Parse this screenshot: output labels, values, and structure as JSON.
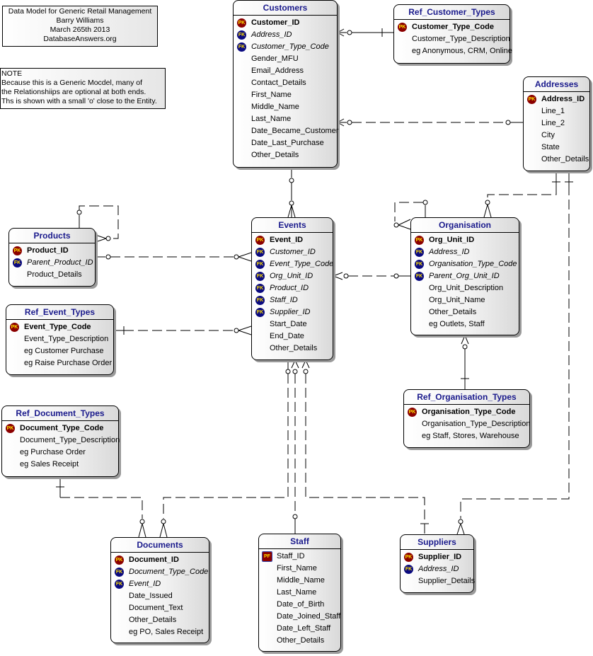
{
  "title_note": {
    "lines": [
      "Data Model for Generic Retail Management",
      "Barry Williams",
      "March 265th 2013",
      "DatabaseAnswers.org"
    ]
  },
  "info_note": {
    "lines": [
      "NOTE",
      "Because this is a Generic Mocdel, many of",
      "the Relationshiips are optional at both ends.",
      " Ths is shown with a small 'o' close to the Entity."
    ]
  },
  "key_labels": {
    "pk": "PK",
    "fk": "FK",
    "pf": "PF"
  },
  "colors": {
    "entity_title": "#1a1a8c",
    "pk_badge": "#8b0000",
    "fk_badge": "#0a0a80",
    "badge_text": "#ffe000"
  },
  "entities": {
    "customers": {
      "name": "Customers",
      "rows": [
        {
          "key": "pk",
          "label": "Customer_ID"
        },
        {
          "key": "fk",
          "label": "Address_ID"
        },
        {
          "key": "fk",
          "label": "Customer_Type_Code"
        },
        {
          "key": "",
          "label": "Gender_MFU"
        },
        {
          "key": "",
          "label": "Email_Address"
        },
        {
          "key": "",
          "label": "Contact_Details"
        },
        {
          "key": "",
          "label": "First_Name"
        },
        {
          "key": "",
          "label": "Middle_Name"
        },
        {
          "key": "",
          "label": "Last_Name"
        },
        {
          "key": "",
          "label": "Date_Became_Customer"
        },
        {
          "key": "",
          "label": "Date_Last_Purchase"
        },
        {
          "key": "",
          "label": "Other_Details"
        }
      ]
    },
    "ref_customer_types": {
      "name": "Ref_Customer_Types",
      "rows": [
        {
          "key": "pk",
          "label": "Customer_Type_Code"
        },
        {
          "key": "",
          "label": "Customer_Type_Description"
        },
        {
          "key": "",
          "label": "eg Anonymous, CRM, Online"
        }
      ]
    },
    "addresses": {
      "name": "Addresses",
      "rows": [
        {
          "key": "pk",
          "label": "Address_ID"
        },
        {
          "key": "",
          "label": "Line_1"
        },
        {
          "key": "",
          "label": "Line_2"
        },
        {
          "key": "",
          "label": "City"
        },
        {
          "key": "",
          "label": "State"
        },
        {
          "key": "",
          "label": "Other_Details"
        }
      ]
    },
    "products": {
      "name": "Products",
      "rows": [
        {
          "key": "pk",
          "label": "Product_ID"
        },
        {
          "key": "fk",
          "label": "Parent_Product_ID"
        },
        {
          "key": "",
          "label": "Product_Details"
        }
      ]
    },
    "events": {
      "name": "Events",
      "rows": [
        {
          "key": "pk",
          "label": "Event_ID"
        },
        {
          "key": "fk",
          "label": "Customer_ID"
        },
        {
          "key": "fk",
          "label": "Event_Type_Code"
        },
        {
          "key": "fk",
          "label": "Org_Unit_ID"
        },
        {
          "key": "fk",
          "label": "Product_ID"
        },
        {
          "key": "fk",
          "label": "Staff_ID"
        },
        {
          "key": "fk",
          "label": "Supplier_ID"
        },
        {
          "key": "",
          "label": "Start_Date"
        },
        {
          "key": "",
          "label": "End_Date"
        },
        {
          "key": "",
          "label": "Other_Details"
        }
      ]
    },
    "organisation": {
      "name": "Organisation",
      "rows": [
        {
          "key": "pk",
          "label": "Org_Unit_ID"
        },
        {
          "key": "fk",
          "label": "Address_ID"
        },
        {
          "key": "fk",
          "label": "Organisation_Type_Code"
        },
        {
          "key": "fk",
          "label": "Parent_Org_Unit_ID"
        },
        {
          "key": "",
          "label": "Org_Unit_Description"
        },
        {
          "key": "",
          "label": "Org_Unit_Name"
        },
        {
          "key": "",
          "label": "Other_Details"
        },
        {
          "key": "",
          "label": "eg Outlets, Staff"
        }
      ]
    },
    "ref_event_types": {
      "name": "Ref_Event_Types",
      "rows": [
        {
          "key": "pk",
          "label": "Event_Type_Code"
        },
        {
          "key": "",
          "label": "Event_Type_Description"
        },
        {
          "key": "",
          "label": "eg Customer Purchase"
        },
        {
          "key": "",
          "label": "eg Raise Purchase Order"
        }
      ]
    },
    "ref_organisation_types": {
      "name": "Ref_Organisation_Types",
      "rows": [
        {
          "key": "pk",
          "label": "Organisation_Type_Code"
        },
        {
          "key": "",
          "label": "Organisation_Type_Description"
        },
        {
          "key": "",
          "label": "eg Staff, Stores, Warehouse"
        }
      ]
    },
    "ref_document_types": {
      "name": "Ref_Document_Types",
      "rows": [
        {
          "key": "pk",
          "label": "Document_Type_Code"
        },
        {
          "key": "",
          "label": "Document_Type_Description"
        },
        {
          "key": "",
          "label": "eg Purchase Order"
        },
        {
          "key": "",
          "label": "eg Sales Receipt"
        }
      ]
    },
    "documents": {
      "name": "Documents",
      "rows": [
        {
          "key": "pk",
          "label": "Document_ID"
        },
        {
          "key": "fk",
          "label": "Document_Type_Code"
        },
        {
          "key": "fk",
          "label": "Event_ID"
        },
        {
          "key": "",
          "label": "Date_Issued"
        },
        {
          "key": "",
          "label": "Document_Text"
        },
        {
          "key": "",
          "label": "Other_Details"
        },
        {
          "key": "",
          "label": "eg PO, Sales Receipt"
        }
      ]
    },
    "staff": {
      "name": "Staff",
      "rows": [
        {
          "key": "pf",
          "label": "Staff_ID"
        },
        {
          "key": "",
          "label": "First_Name"
        },
        {
          "key": "",
          "label": "Middle_Name"
        },
        {
          "key": "",
          "label": "Last_Name"
        },
        {
          "key": "",
          "label": "Date_of_Birth"
        },
        {
          "key": "",
          "label": "Date_Joined_Staff"
        },
        {
          "key": "",
          "label": "Date_Left_Staff"
        },
        {
          "key": "",
          "label": "Other_Details"
        }
      ]
    },
    "suppliers": {
      "name": "Suppliers",
      "rows": [
        {
          "key": "pk",
          "label": "Supplier_ID"
        },
        {
          "key": "fk",
          "label": "Address_ID"
        },
        {
          "key": "",
          "label": "Supplier_Details"
        }
      ]
    }
  }
}
